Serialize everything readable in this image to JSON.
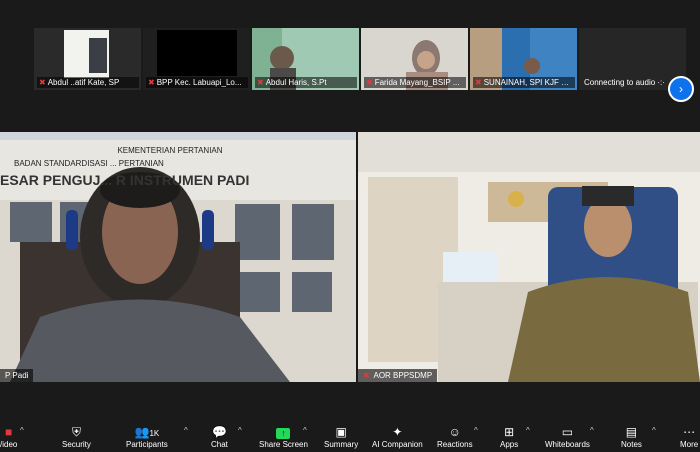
{
  "thumbnails": [
    {
      "label": "Abdul ..atif Kate, SP",
      "muted": true
    },
    {
      "label": "BPP Kec. Labuapi_Lo...",
      "muted": true
    },
    {
      "label": "Abdul Haris, S.Pt",
      "muted": true
    },
    {
      "label": "Farida Mayang_BSIP ...",
      "muted": true
    },
    {
      "label": "SUNAINAH, SPI KJF D...",
      "muted": true
    },
    {
      "label": "Connecting to audio ·:·",
      "muted": false
    }
  ],
  "left_tile": {
    "label": "P Padi",
    "sign_line1": "KEMENTERIAN PERTANIAN",
    "sign_line2": "BADAN STANDARDISASI ... PERTANIAN",
    "sign_line3": "ESAR PENGUJ... R INSTRUMEN PADI"
  },
  "right_tile": {
    "label": "AOR BPPSDMP"
  },
  "toolbar": {
    "video": "/ideo",
    "security": "Security",
    "participants": "Participants",
    "participants_count": "1K",
    "chat": "Chat",
    "share": "Share Screen",
    "summary": "Summary",
    "ai": "AI Companion",
    "reactions": "Reactions",
    "apps": "Apps",
    "whiteboards": "Whiteboards",
    "notes": "Notes",
    "more": "More"
  },
  "colors": {
    "share_green": "#23d959",
    "mute_red": "#e0393e",
    "accent_blue": "#0e72ed"
  }
}
